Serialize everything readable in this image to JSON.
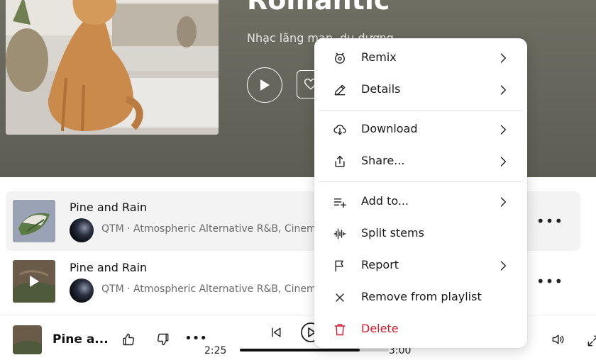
{
  "header": {
    "title": "Romantic",
    "subtitle": "Nhạc lãng mạn, du dương"
  },
  "tracks": [
    {
      "title": "Pine and Rain",
      "meta": "QTM · Atmospheric Alternative R&B, Cinematic",
      "more": "•••"
    },
    {
      "title": "Pine and Rain",
      "meta": "QTM · Atmospheric Alternative R&B, Cinematic",
      "more": "•••"
    }
  ],
  "player": {
    "title": "Pine a...",
    "elapsed": "2:25",
    "duration": "3:00",
    "progress_fraction": 0.805,
    "more": "•••"
  },
  "menu": {
    "items": [
      {
        "label": "Remix",
        "icon": "remix-icon",
        "submenu": true
      },
      {
        "label": "Details",
        "icon": "pencil-icon",
        "submenu": true
      },
      {
        "label": "Download",
        "icon": "cloud-download-icon",
        "submenu": true
      },
      {
        "label": "Share...",
        "icon": "share-icon",
        "submenu": true
      },
      {
        "label": "Add to...",
        "icon": "add-to-list-icon",
        "submenu": true
      },
      {
        "label": "Split stems",
        "icon": "waveform-icon",
        "submenu": false
      },
      {
        "label": "Report",
        "icon": "flag-icon",
        "submenu": true
      },
      {
        "label": "Remove from playlist",
        "icon": "close-icon",
        "submenu": false
      },
      {
        "label": "Delete",
        "icon": "trash-icon",
        "submenu": false
      }
    ]
  },
  "colors": {
    "header_bg": "#6f6e63",
    "danger": "#d11a2a",
    "highlight_row": "#f3f3f3"
  }
}
